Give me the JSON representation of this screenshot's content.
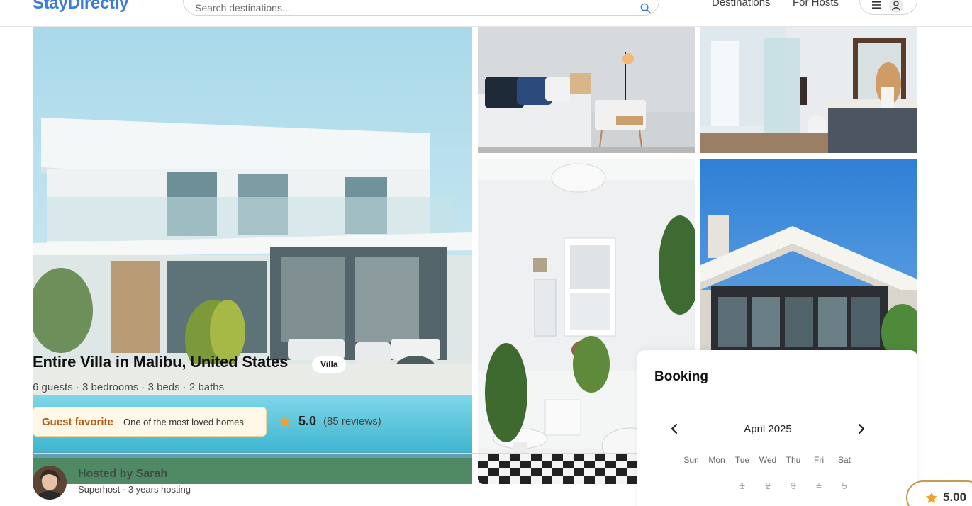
{
  "header": {
    "logo": "StayDirectly",
    "search_placeholder": "Search destinations...",
    "nav": [
      "Destinations",
      "For Hosts"
    ]
  },
  "listing": {
    "title": "Entire Villa in Malibu, United States",
    "type_badge": "Villa",
    "meta": "6 guests · 3 bedrooms · 3 beds · 2 baths",
    "guest_favorite": {
      "title": "Guest favorite",
      "description": "One of the most loved homes"
    },
    "rating": "5.0",
    "reviews": "(85 reviews)"
  },
  "host": {
    "name": "Hosted by Sarah",
    "subtitle": "Superhost · 3 years hosting"
  },
  "booking": {
    "title": "Booking",
    "month": "April 2025",
    "weekdays": [
      "Sun",
      "Mon",
      "Tue",
      "Wed",
      "Thu",
      "Fri",
      "Sat"
    ],
    "days": [
      "1",
      "2",
      "3",
      "4",
      "5"
    ]
  },
  "floating_rating": "5.00",
  "colors": {
    "brand": "#3b7be0",
    "favorite_text": "#b35a10",
    "favorite_bg": "#fff8e8",
    "star": "#f0a030"
  }
}
